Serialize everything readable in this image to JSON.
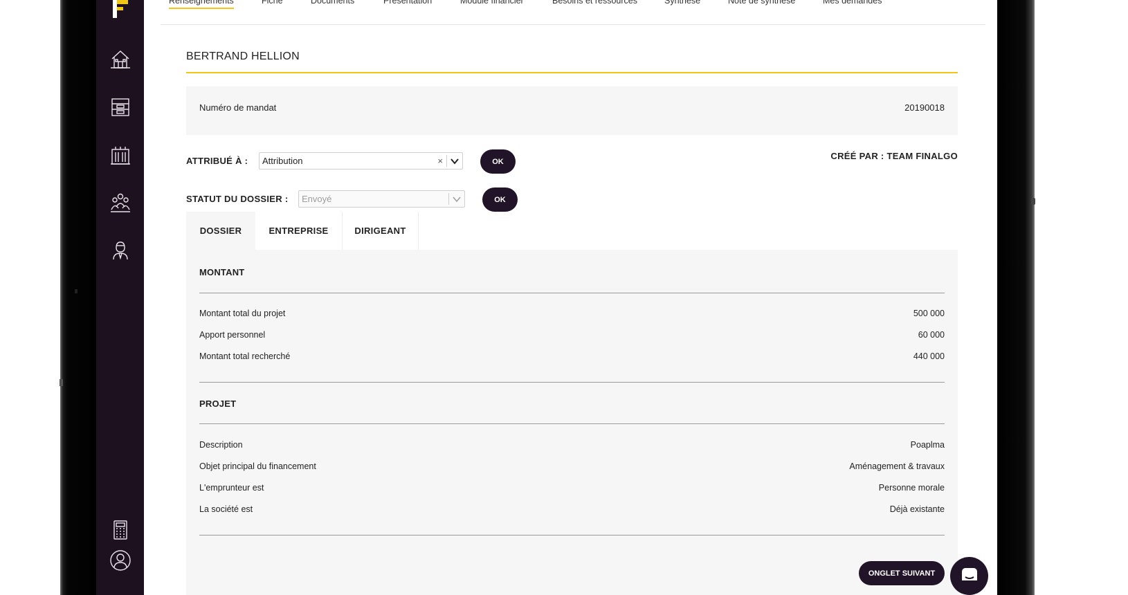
{
  "topnav": {
    "items": [
      {
        "label": "Renseignements",
        "active": true
      },
      {
        "label": "Fiche"
      },
      {
        "label": "Documents"
      },
      {
        "label": "Présentation"
      },
      {
        "label": "Module financier"
      },
      {
        "label": "Besoins et ressources"
      },
      {
        "label": "Synthèse"
      },
      {
        "label": "Note de synthèse"
      },
      {
        "label": "Mes demandes"
      }
    ]
  },
  "sidebar": {
    "icons": [
      "house-icon",
      "archive-box-icon",
      "building-icon",
      "team-icon",
      "advisor-icon",
      "calculator-icon",
      "user-profile-icon"
    ]
  },
  "header": {
    "client_name": "BERTRAND HELLION"
  },
  "mandat": {
    "label": "Numéro de mandat",
    "value": "20190018"
  },
  "attribution": {
    "label": "ATTRIBUÉ À :",
    "value": "Attribution",
    "clear": "×",
    "ok": "OK"
  },
  "statut": {
    "label": "STATUT DU DOSSIER :",
    "value": "Envoyé",
    "ok": "OK"
  },
  "created_by": "CRÉÉ PAR : TEAM FINALGO",
  "tabs": [
    {
      "label": "DOSSIER",
      "active": true
    },
    {
      "label": "ENTREPRISE"
    },
    {
      "label": "DIRIGEANT"
    }
  ],
  "montant": {
    "title": "MONTANT",
    "rows": [
      {
        "label": "Montant total du projet",
        "value": "500 000"
      },
      {
        "label": "Apport personnel",
        "value": "60 000"
      },
      {
        "label": "Montant total recherché",
        "value": "440 000"
      }
    ]
  },
  "projet": {
    "title": "PROJET",
    "rows": [
      {
        "label": "Description",
        "value": "Poaplma"
      },
      {
        "label": "Objet principal du financement",
        "value": "Aménagement & travaux"
      },
      {
        "label": "L'emprunteur est",
        "value": "Personne morale"
      },
      {
        "label": "La société est",
        "value": "Déjà existante"
      }
    ]
  },
  "footer": {
    "next_label": "ONGLET SUIVANT"
  },
  "colors": {
    "accent": "#f2c519",
    "sidebar": "#1d1120",
    "button": "#221428",
    "panel": "#f6f6f6"
  }
}
